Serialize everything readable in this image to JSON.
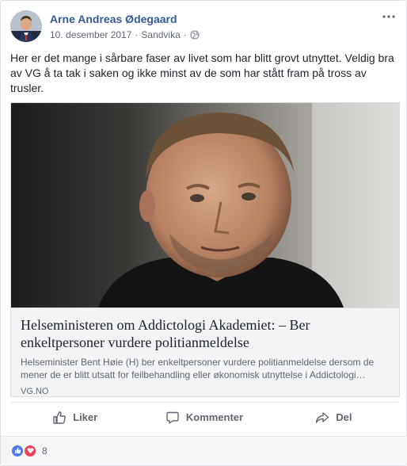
{
  "post": {
    "author": "Arne Andreas Ødegaard",
    "date": "10. desember 2017",
    "location": "Sandvika",
    "separator": "·",
    "privacy_icon": "globe-icon",
    "text": "Her er det mange i sårbare faser av livet som har blitt grovt utnyttet. Veldig bra av VG å ta tak i saken og ikke minst av de som har stått fram på tross av trusler."
  },
  "link": {
    "title": "Helseministeren om Addictologi Akademiet: – Ber enkeltpersoner vurdere politianmeldelse",
    "description": "Helseminister Bent Høie (H) ber enkeltpersoner vurdere politianmeldelse dersom de mener de er blitt utsatt for feilbehandling eller økonomisk utnyttelse i Addictologi…",
    "domain": "VG.NO"
  },
  "actions": {
    "like": "Liker",
    "comment": "Kommenter",
    "share": "Del"
  },
  "reactions": {
    "types": [
      "like-icon",
      "love-icon"
    ],
    "count": "8"
  },
  "colors": {
    "author": "#385898",
    "like": "#4b7bec",
    "love": "#f33e58"
  }
}
